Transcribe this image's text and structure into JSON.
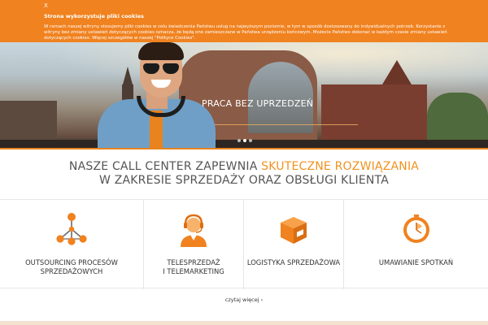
{
  "cookie": {
    "close": "X",
    "title": "Strona wykorzystuje pliki cookies",
    "text": "W ramach naszej witryny stosujemy pliki cookies w celu świadczenia Państwu usług na najwyższym poziomie, w tym w sposób dostosowany do indywidualnych potrzeb. Korzystanie z witryny bez zmiany ustawień dotyczących cookies oznacza, że będą one zamieszczane w Państwa urządzeniu końcowym. Możecie Państwo dokonać w każdym czasie zmiany ustawień dotyczących cookies. Więcej szczegółów w naszej \"Polityce Cookies\"."
  },
  "hero": {
    "caption": "PRACA BEZ UPRZEDZEŃ",
    "slides": 3,
    "active_slide": 2
  },
  "headline": {
    "line1_prefix": "NASZE CALL CENTER ZAPEWNIA ",
    "line1_accent": "SKUTECZNE ROZWIĄZANIA",
    "line2": "W ZAKRESIE SPRZEDAŻY ORAZ OBSŁUGI KLIENTA"
  },
  "services": [
    {
      "icon": "network-icon",
      "line1": "OUTSOURCING PROCESÓW",
      "line2": "SPRZEDAŻOWYCH"
    },
    {
      "icon": "headset-agent-icon",
      "line1": "TELESPRZEDAŻ",
      "line2": "I TELEMARKETING"
    },
    {
      "icon": "package-icon",
      "line1": "LOGISTYKA SPRZEDAŻOWA",
      "line2": ""
    },
    {
      "icon": "clock-icon",
      "line1": "UMAWIANIE SPOTKAŃ",
      "line2": ""
    }
  ],
  "more_link": "czytaj więcej",
  "colors": {
    "accent": "#f0821f",
    "text": "#555555",
    "divider": "#e6e6e6"
  }
}
